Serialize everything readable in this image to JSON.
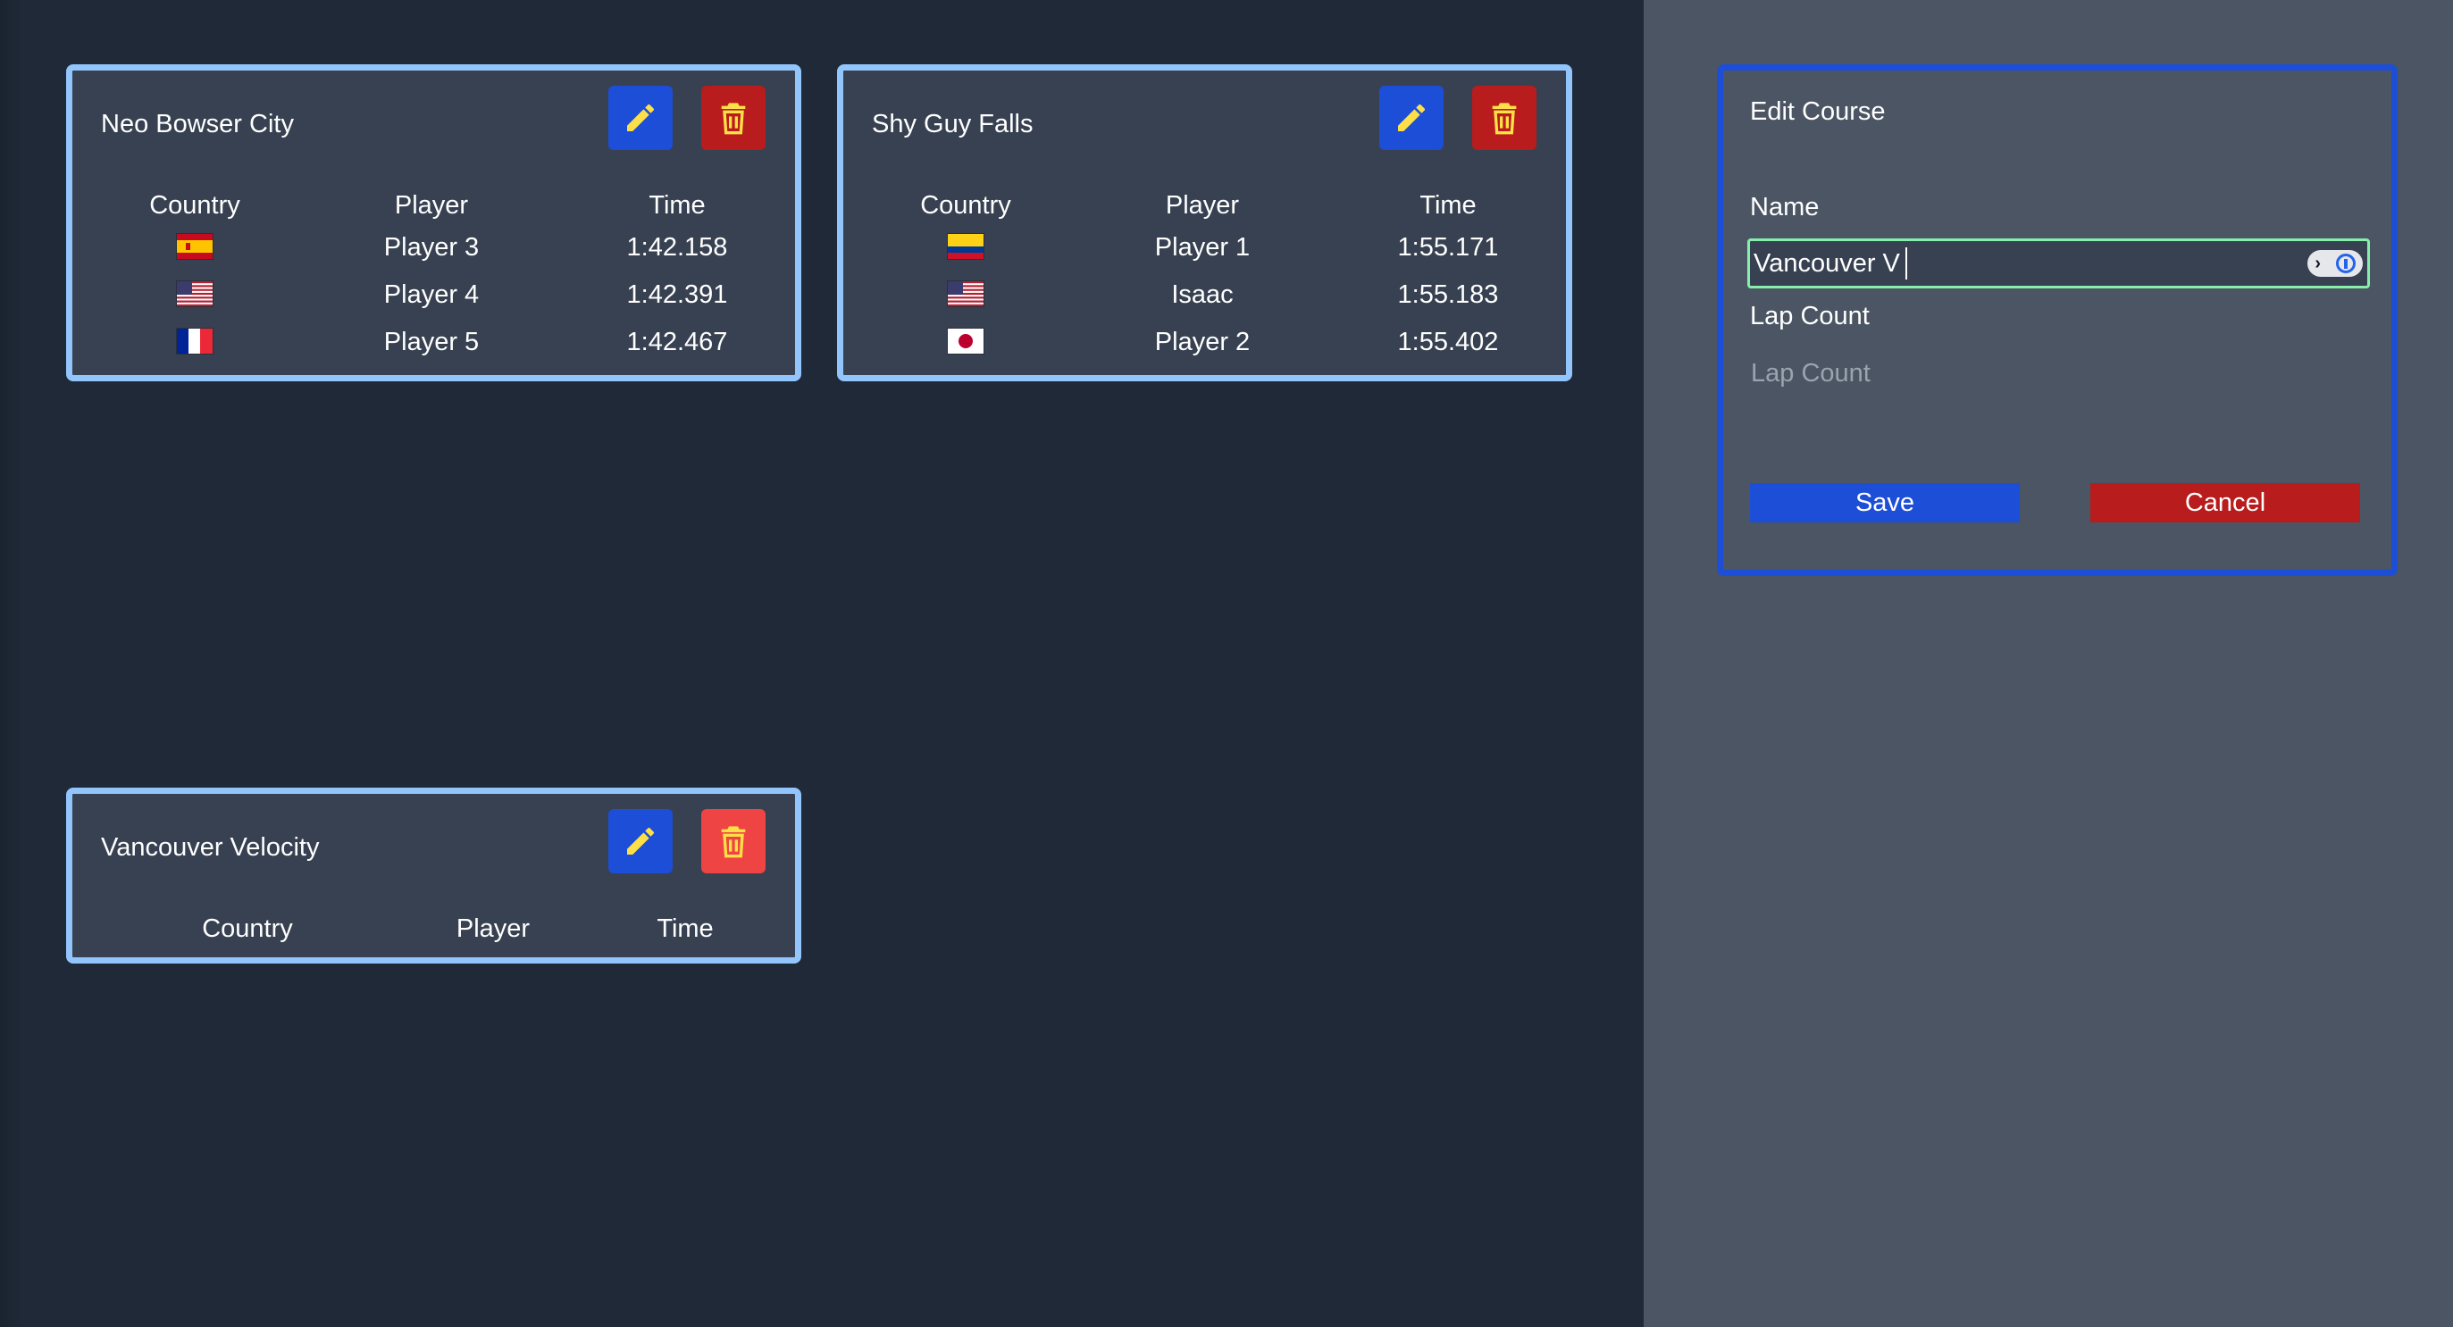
{
  "colors": {
    "background": "#1f2937",
    "sidebar": "#4b5563",
    "card": "#374151",
    "card_border": "#93c5fd",
    "panel_border": "#1d4ed8",
    "edit_button": "#1d4ed8",
    "delete_button": "#b91c1c",
    "icon": "#fde047",
    "input_focus_border": "#86efac"
  },
  "table_headers": {
    "country": "Country",
    "player": "Player",
    "time": "Time"
  },
  "courses": [
    {
      "name": "Neo Bowser City",
      "edit_icon": "pencil-icon",
      "delete_icon": "trash-icon",
      "rows": [
        {
          "country_flag": "spain-flag",
          "player": "Player 3",
          "time": "1:42.158"
        },
        {
          "country_flag": "usa-flag",
          "player": "Player 4",
          "time": "1:42.391"
        },
        {
          "country_flag": "france-flag",
          "player": "Player 5",
          "time": "1:42.467"
        }
      ]
    },
    {
      "name": "Shy Guy Falls",
      "edit_icon": "pencil-icon",
      "delete_icon": "trash-icon",
      "rows": [
        {
          "country_flag": "colombia-flag",
          "player": "Player 1",
          "time": "1:55.171"
        },
        {
          "country_flag": "usa-flag",
          "player": "Isaac",
          "time": "1:55.183"
        },
        {
          "country_flag": "japan-flag",
          "player": "Player 2",
          "time": "1:55.402"
        }
      ]
    },
    {
      "name": "Vancouver Velocity",
      "edit_icon": "pencil-icon",
      "delete_icon": "trash-icon",
      "rows": []
    }
  ],
  "edit_panel": {
    "title": "Edit Course",
    "name_label": "Name",
    "name_value": "Vancouver V",
    "password_manager_icon": "password-manager-icon",
    "lap_count_label": "Lap Count",
    "lap_count_placeholder": "Lap Count",
    "save_label": "Save",
    "cancel_label": "Cancel"
  }
}
